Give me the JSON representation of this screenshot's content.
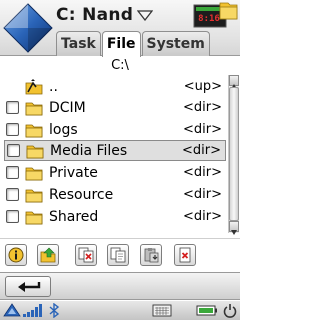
{
  "header": {
    "drive_label": "C: Nand",
    "clock": "8:16",
    "tabs": [
      {
        "label": "Task",
        "active": false
      },
      {
        "label": "File",
        "active": true
      },
      {
        "label": "System",
        "active": false
      }
    ]
  },
  "path": "C:\\",
  "files": [
    {
      "name": "..",
      "type": "<up>",
      "icon": "folder-up-icon",
      "checkbox": false,
      "selected": false
    },
    {
      "name": "DCIM",
      "type": "<dir>",
      "icon": "folder-icon",
      "checkbox": true,
      "selected": false
    },
    {
      "name": "logs",
      "type": "<dir>",
      "icon": "folder-icon",
      "checkbox": true,
      "selected": false
    },
    {
      "name": "Media Files",
      "type": "<dir>",
      "icon": "folder-icon",
      "checkbox": true,
      "selected": true
    },
    {
      "name": "Private",
      "type": "<dir>",
      "icon": "folder-icon",
      "checkbox": true,
      "selected": false
    },
    {
      "name": "Resource",
      "type": "<dir>",
      "icon": "folder-icon",
      "checkbox": true,
      "selected": false
    },
    {
      "name": "Shared",
      "type": "<dir>",
      "icon": "folder-icon",
      "checkbox": true,
      "selected": false
    }
  ],
  "toolbar": {
    "buttons": [
      "info-icon",
      "folder-up-arrow-icon",
      "cut-icon",
      "copy-icon",
      "paste-icon",
      "delete-icon"
    ]
  },
  "back": {
    "icon": "back-arrow-icon"
  },
  "statusbar": {
    "icons": [
      "network-icon",
      "signal-bars-icon",
      "bluetooth-icon",
      "keyboard-icon",
      "battery-icon",
      "power-icon"
    ]
  },
  "colors": {
    "accent_blue": "#2a64b8",
    "folder_yellow": "#f2c230",
    "delete_red": "#d42020",
    "clock_red": "#e53030"
  }
}
